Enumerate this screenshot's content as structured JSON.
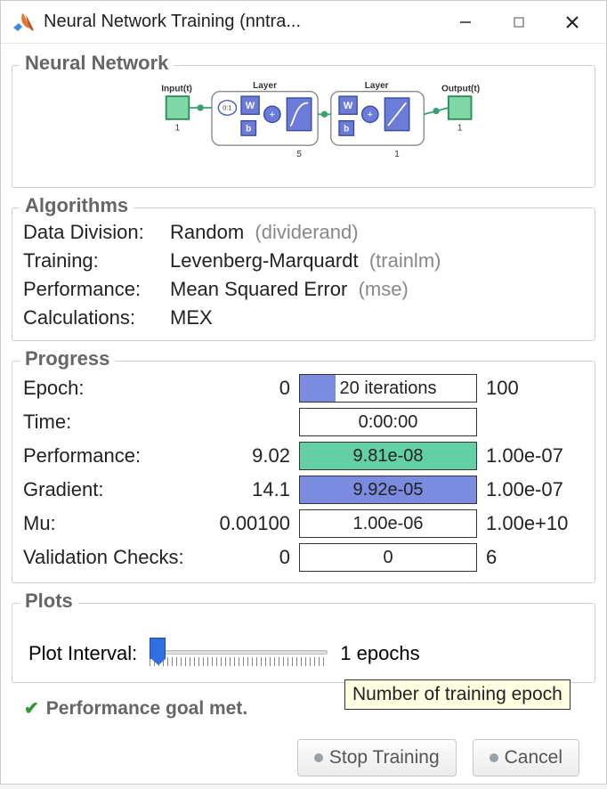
{
  "window": {
    "title": "Neural Network Training (nntra..."
  },
  "sections": {
    "network": "Neural Network",
    "algorithms": "Algorithms",
    "progress": "Progress",
    "plots": "Plots"
  },
  "diagram": {
    "input_label": "Input(t)",
    "output_label": "Output(t)",
    "layer_label": "Layer",
    "input_size": "1",
    "layer1_size": "5",
    "layer2_size": "1",
    "output_size": "1",
    "delay_label": "0:1"
  },
  "algorithms": {
    "data_division_label": "Data Division:",
    "data_division_value": "Random",
    "data_division_fn": "(dividerand)",
    "training_label": "Training:",
    "training_value": "Levenberg-Marquardt",
    "training_fn": "(trainlm)",
    "performance_label": "Performance:",
    "performance_value": "Mean Squared Error",
    "performance_fn": "(mse)",
    "calculations_label": "Calculations:",
    "calculations_value": "MEX"
  },
  "progress": {
    "rows": {
      "epoch": {
        "label": "Epoch:",
        "start": "0",
        "bar": "20 iterations",
        "fill_pct": 20,
        "fill_class": "fill-blue",
        "end": "100"
      },
      "time": {
        "label": "Time:",
        "start": "",
        "bar": "0:00:00",
        "fill_pct": 0,
        "fill_class": "",
        "end": ""
      },
      "perf": {
        "label": "Performance:",
        "start": "9.02",
        "bar": "9.81e-08",
        "fill_pct": 100,
        "fill_class": "fill-green",
        "end": "1.00e-07"
      },
      "grad": {
        "label": "Gradient:",
        "start": "14.1",
        "bar": "9.92e-05",
        "fill_pct": 100,
        "fill_class": "fill-blue",
        "end": "1.00e-07"
      },
      "mu": {
        "label": "Mu:",
        "start": "0.00100",
        "bar": "1.00e-06",
        "fill_pct": 0,
        "fill_class": "",
        "end": "1.00e+10"
      },
      "val": {
        "label": "Validation Checks:",
        "start": "0",
        "bar": "0",
        "fill_pct": 0,
        "fill_class": "",
        "end": "6"
      }
    }
  },
  "plots": {
    "interval_label": "Plot Interval:",
    "interval_value": "1 epochs",
    "tooltip": "Number of training epoch"
  },
  "status": {
    "text": "Performance goal met."
  },
  "buttons": {
    "stop": "Stop Training",
    "cancel": "Cancel"
  }
}
